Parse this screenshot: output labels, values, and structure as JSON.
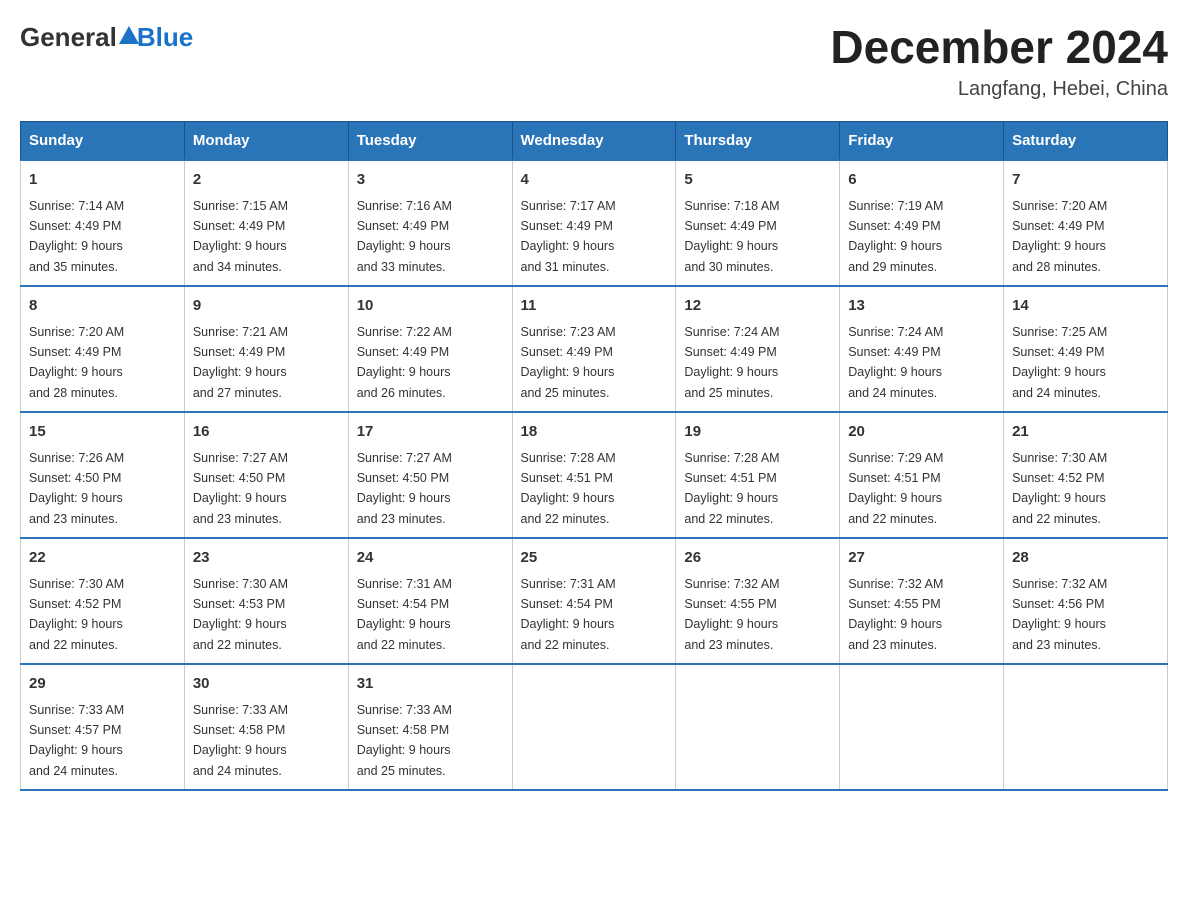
{
  "header": {
    "logo_text_general": "General",
    "logo_text_blue": "Blue",
    "month_title": "December 2024",
    "location": "Langfang, Hebei, China"
  },
  "days_of_week": [
    "Sunday",
    "Monday",
    "Tuesday",
    "Wednesday",
    "Thursday",
    "Friday",
    "Saturday"
  ],
  "weeks": [
    [
      {
        "day": "1",
        "sunrise": "7:14 AM",
        "sunset": "4:49 PM",
        "daylight": "9 hours and 35 minutes."
      },
      {
        "day": "2",
        "sunrise": "7:15 AM",
        "sunset": "4:49 PM",
        "daylight": "9 hours and 34 minutes."
      },
      {
        "day": "3",
        "sunrise": "7:16 AM",
        "sunset": "4:49 PM",
        "daylight": "9 hours and 33 minutes."
      },
      {
        "day": "4",
        "sunrise": "7:17 AM",
        "sunset": "4:49 PM",
        "daylight": "9 hours and 31 minutes."
      },
      {
        "day": "5",
        "sunrise": "7:18 AM",
        "sunset": "4:49 PM",
        "daylight": "9 hours and 30 minutes."
      },
      {
        "day": "6",
        "sunrise": "7:19 AM",
        "sunset": "4:49 PM",
        "daylight": "9 hours and 29 minutes."
      },
      {
        "day": "7",
        "sunrise": "7:20 AM",
        "sunset": "4:49 PM",
        "daylight": "9 hours and 28 minutes."
      }
    ],
    [
      {
        "day": "8",
        "sunrise": "7:20 AM",
        "sunset": "4:49 PM",
        "daylight": "9 hours and 28 minutes."
      },
      {
        "day": "9",
        "sunrise": "7:21 AM",
        "sunset": "4:49 PM",
        "daylight": "9 hours and 27 minutes."
      },
      {
        "day": "10",
        "sunrise": "7:22 AM",
        "sunset": "4:49 PM",
        "daylight": "9 hours and 26 minutes."
      },
      {
        "day": "11",
        "sunrise": "7:23 AM",
        "sunset": "4:49 PM",
        "daylight": "9 hours and 25 minutes."
      },
      {
        "day": "12",
        "sunrise": "7:24 AM",
        "sunset": "4:49 PM",
        "daylight": "9 hours and 25 minutes."
      },
      {
        "day": "13",
        "sunrise": "7:24 AM",
        "sunset": "4:49 PM",
        "daylight": "9 hours and 24 minutes."
      },
      {
        "day": "14",
        "sunrise": "7:25 AM",
        "sunset": "4:49 PM",
        "daylight": "9 hours and 24 minutes."
      }
    ],
    [
      {
        "day": "15",
        "sunrise": "7:26 AM",
        "sunset": "4:50 PM",
        "daylight": "9 hours and 23 minutes."
      },
      {
        "day": "16",
        "sunrise": "7:27 AM",
        "sunset": "4:50 PM",
        "daylight": "9 hours and 23 minutes."
      },
      {
        "day": "17",
        "sunrise": "7:27 AM",
        "sunset": "4:50 PM",
        "daylight": "9 hours and 23 minutes."
      },
      {
        "day": "18",
        "sunrise": "7:28 AM",
        "sunset": "4:51 PM",
        "daylight": "9 hours and 22 minutes."
      },
      {
        "day": "19",
        "sunrise": "7:28 AM",
        "sunset": "4:51 PM",
        "daylight": "9 hours and 22 minutes."
      },
      {
        "day": "20",
        "sunrise": "7:29 AM",
        "sunset": "4:51 PM",
        "daylight": "9 hours and 22 minutes."
      },
      {
        "day": "21",
        "sunrise": "7:30 AM",
        "sunset": "4:52 PM",
        "daylight": "9 hours and 22 minutes."
      }
    ],
    [
      {
        "day": "22",
        "sunrise": "7:30 AM",
        "sunset": "4:52 PM",
        "daylight": "9 hours and 22 minutes."
      },
      {
        "day": "23",
        "sunrise": "7:30 AM",
        "sunset": "4:53 PM",
        "daylight": "9 hours and 22 minutes."
      },
      {
        "day": "24",
        "sunrise": "7:31 AM",
        "sunset": "4:54 PM",
        "daylight": "9 hours and 22 minutes."
      },
      {
        "day": "25",
        "sunrise": "7:31 AM",
        "sunset": "4:54 PM",
        "daylight": "9 hours and 22 minutes."
      },
      {
        "day": "26",
        "sunrise": "7:32 AM",
        "sunset": "4:55 PM",
        "daylight": "9 hours and 23 minutes."
      },
      {
        "day": "27",
        "sunrise": "7:32 AM",
        "sunset": "4:55 PM",
        "daylight": "9 hours and 23 minutes."
      },
      {
        "day": "28",
        "sunrise": "7:32 AM",
        "sunset": "4:56 PM",
        "daylight": "9 hours and 23 minutes."
      }
    ],
    [
      {
        "day": "29",
        "sunrise": "7:33 AM",
        "sunset": "4:57 PM",
        "daylight": "9 hours and 24 minutes."
      },
      {
        "day": "30",
        "sunrise": "7:33 AM",
        "sunset": "4:58 PM",
        "daylight": "9 hours and 24 minutes."
      },
      {
        "day": "31",
        "sunrise": "7:33 AM",
        "sunset": "4:58 PM",
        "daylight": "9 hours and 25 minutes."
      },
      null,
      null,
      null,
      null
    ]
  ],
  "labels": {
    "sunrise": "Sunrise:",
    "sunset": "Sunset:",
    "daylight": "Daylight:"
  }
}
